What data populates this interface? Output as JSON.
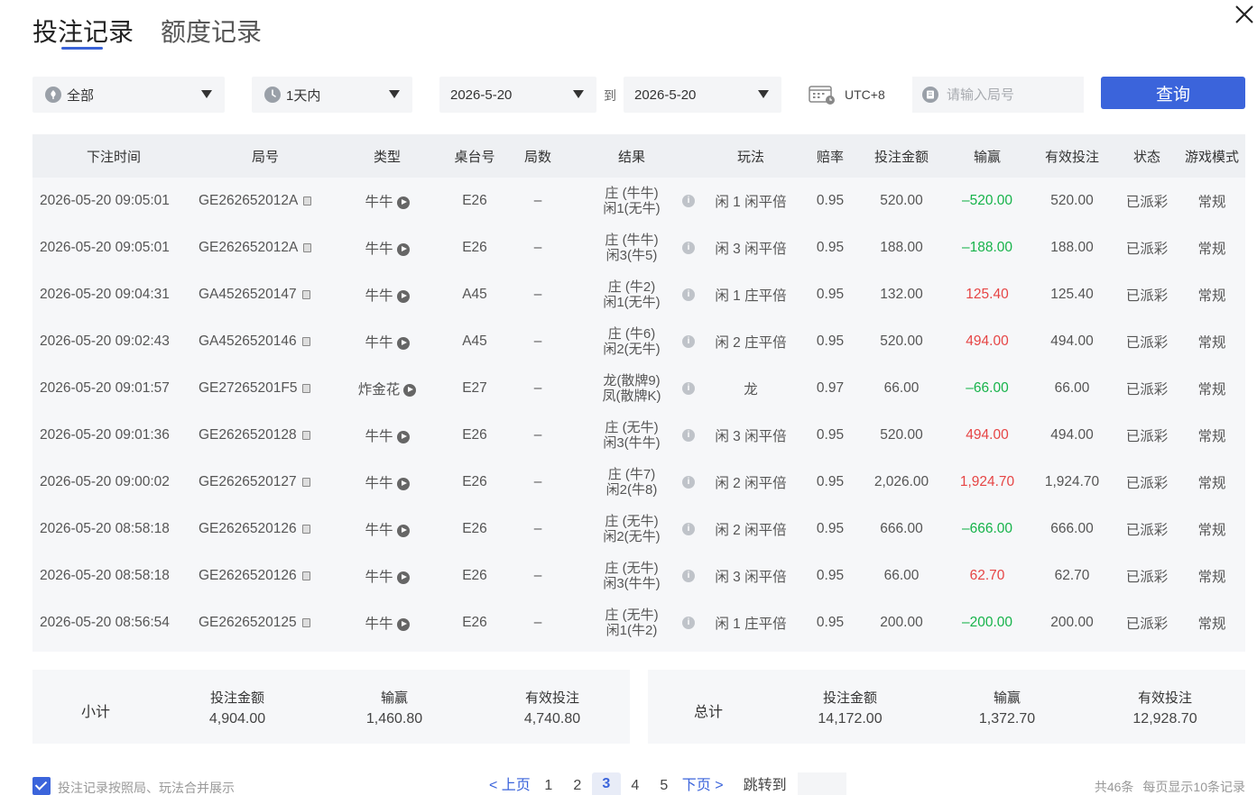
{
  "tabs": [
    {
      "label": "投注记录",
      "active": true
    },
    {
      "label": "额度记录",
      "active": false
    }
  ],
  "filters": {
    "game_filter": "全部",
    "time_range": "1天内",
    "date_from": "2026-5-20",
    "to_label": "到",
    "date_to": "2026-5-20",
    "timezone": "UTC+8",
    "round_placeholder": "请输入局号",
    "query_label": "查询"
  },
  "table": {
    "columns": [
      "下注时间",
      "局号",
      "类型",
      "桌台号",
      "局数",
      "结果",
      "玩法",
      "赔率",
      "投注金额",
      "输赢",
      "有效投注",
      "状态",
      "游戏模式"
    ],
    "rows": [
      {
        "time": "2026-05-20 09:05:01",
        "round": "GE262652012A",
        "type": "牛牛",
        "table": "E26",
        "count": "–",
        "result1": "庄 (牛牛)",
        "result2": "闲1(无牛)",
        "play": "闲 1 闲平倍",
        "odds": "0.95",
        "bet": "520.00",
        "winloss": "–520.00",
        "outcome": "lose",
        "valid": "520.00",
        "status": "已派彩",
        "mode": "常规"
      },
      {
        "time": "2026-05-20 09:05:01",
        "round": "GE262652012A",
        "type": "牛牛",
        "table": "E26",
        "count": "–",
        "result1": "庄 (牛牛)",
        "result2": "闲3(牛5)",
        "play": "闲 3 闲平倍",
        "odds": "0.95",
        "bet": "188.00",
        "winloss": "–188.00",
        "outcome": "lose",
        "valid": "188.00",
        "status": "已派彩",
        "mode": "常规"
      },
      {
        "time": "2026-05-20 09:04:31",
        "round": "GA4526520147",
        "type": "牛牛",
        "table": "A45",
        "count": "–",
        "result1": "庄 (牛2)",
        "result2": "闲1(无牛)",
        "play": "闲 1 庄平倍",
        "odds": "0.95",
        "bet": "132.00",
        "winloss": "125.40",
        "outcome": "win",
        "valid": "125.40",
        "status": "已派彩",
        "mode": "常规"
      },
      {
        "time": "2026-05-20 09:02:43",
        "round": "GA4526520146",
        "type": "牛牛",
        "table": "A45",
        "count": "–",
        "result1": "庄 (牛6)",
        "result2": "闲2(无牛)",
        "play": "闲 2 庄平倍",
        "odds": "0.95",
        "bet": "520.00",
        "winloss": "494.00",
        "outcome": "win",
        "valid": "494.00",
        "status": "已派彩",
        "mode": "常规"
      },
      {
        "time": "2026-05-20 09:01:57",
        "round": "GE27265201F5",
        "type": "炸金花",
        "table": "E27",
        "count": "–",
        "result1": "龙(散牌9)",
        "result2": "凤(散牌K)",
        "play": "龙",
        "odds": "0.97",
        "bet": "66.00",
        "winloss": "–66.00",
        "outcome": "lose",
        "valid": "66.00",
        "status": "已派彩",
        "mode": "常规"
      },
      {
        "time": "2026-05-20 09:01:36",
        "round": "GE2626520128",
        "type": "牛牛",
        "table": "E26",
        "count": "–",
        "result1": "庄 (无牛)",
        "result2": "闲3(牛牛)",
        "play": "闲 3 闲平倍",
        "odds": "0.95",
        "bet": "520.00",
        "winloss": "494.00",
        "outcome": "win",
        "valid": "494.00",
        "status": "已派彩",
        "mode": "常规"
      },
      {
        "time": "2026-05-20 09:00:02",
        "round": "GE2626520127",
        "type": "牛牛",
        "table": "E26",
        "count": "–",
        "result1": "庄 (牛7)",
        "result2": "闲2(牛8)",
        "play": "闲 2 闲平倍",
        "odds": "0.95",
        "bet": "2,026.00",
        "winloss": "1,924.70",
        "outcome": "win",
        "valid": "1,924.70",
        "status": "已派彩",
        "mode": "常规"
      },
      {
        "time": "2026-05-20 08:58:18",
        "round": "GE2626520126",
        "type": "牛牛",
        "table": "E26",
        "count": "–",
        "result1": "庄 (无牛)",
        "result2": "闲2(无牛)",
        "play": "闲 2 闲平倍",
        "odds": "0.95",
        "bet": "666.00",
        "winloss": "–666.00",
        "outcome": "lose",
        "valid": "666.00",
        "status": "已派彩",
        "mode": "常规"
      },
      {
        "time": "2026-05-20 08:58:18",
        "round": "GE2626520126",
        "type": "牛牛",
        "table": "E26",
        "count": "–",
        "result1": "庄 (无牛)",
        "result2": "闲3(牛牛)",
        "play": "闲 3 闲平倍",
        "odds": "0.95",
        "bet": "66.00",
        "winloss": "62.70",
        "outcome": "win",
        "valid": "62.70",
        "status": "已派彩",
        "mode": "常规"
      },
      {
        "time": "2026-05-20 08:56:54",
        "round": "GE2626520125",
        "type": "牛牛",
        "table": "E26",
        "count": "–",
        "result1": "庄 (无牛)",
        "result2": "闲1(牛2)",
        "play": "闲 1 庄平倍",
        "odds": "0.95",
        "bet": "200.00",
        "winloss": "–200.00",
        "outcome": "lose",
        "valid": "200.00",
        "status": "已派彩",
        "mode": "常规"
      }
    ]
  },
  "subtotal": {
    "label": "小计",
    "bet_label": "投注金额",
    "bet": "4,904.00",
    "winloss_label": "输赢",
    "winloss": "1,460.80",
    "valid_label": "有效投注",
    "valid": "4,740.80"
  },
  "total": {
    "label": "总计",
    "bet_label": "投注金额",
    "bet": "14,172.00",
    "winloss_label": "输赢",
    "winloss": "1,372.70",
    "valid_label": "有效投注",
    "valid": "12,928.70"
  },
  "footer": {
    "merge_label": "投注记录按照局、玩法合并展示",
    "merge_checked": true,
    "prev_label": "< 上页",
    "next_label": "下页 >",
    "pages": [
      "1",
      "2",
      "3",
      "4",
      "5"
    ],
    "current_page": "3",
    "jump_label": "跳转到",
    "total_count": "共46条",
    "per_page": "每页显示10条记录"
  },
  "colors": {
    "accent": "#3b64db",
    "win": "#e64545",
    "lose": "#16b34a"
  }
}
